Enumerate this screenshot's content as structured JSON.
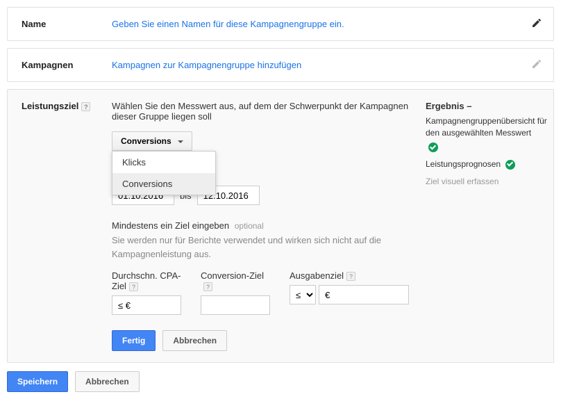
{
  "name_panel": {
    "label": "Name",
    "placeholder_text": "Geben Sie einen Namen für diese Kampagnengruppe ein."
  },
  "campaigns_panel": {
    "label": "Kampagnen",
    "link_text": "Kampagnen zur Kampagnengruppe hinzufügen"
  },
  "goal_panel": {
    "label": "Leistungsziel",
    "instruction": "Wählen Sie den Messwert aus, auf dem der Schwerpunkt der Kampagnen dieser Gruppe liegen soll",
    "metric_selected": "Conversions",
    "metric_options": [
      "Klicks",
      "Conversions"
    ],
    "date_from": "01.10.2016",
    "date_to": "12.10.2016",
    "date_sep": "bis",
    "targets_heading": "Mindestens ein Ziel eingeben",
    "optional_label": "optional",
    "targets_desc": "Sie werden nur für Berichte verwendet und wirken sich nicht auf die Kampagnenleistung aus.",
    "cols": {
      "cpa": {
        "label": "Durchschn. CPA-Ziel",
        "value": "≤ €"
      },
      "conv": {
        "label": "Conversion-Ziel",
        "value": ""
      },
      "spend": {
        "label": "Ausgabenziel",
        "op": "≤",
        "value": "€"
      }
    },
    "done": "Fertig",
    "cancel": "Abbrechen"
  },
  "result_panel": {
    "title": "Ergebnis –",
    "overview": "Kampagnengruppenübersicht für den ausgewählten Messwert",
    "forecast": "Leistungsprognosen",
    "visual": "Ziel visuell erfassen"
  },
  "footer": {
    "save": "Speichern",
    "cancel": "Abbrechen"
  }
}
